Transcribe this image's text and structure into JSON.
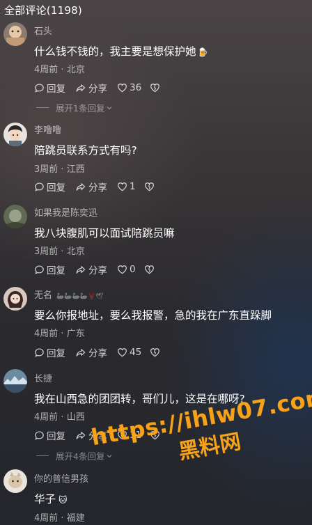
{
  "header": {
    "title": "全部评论(1198)"
  },
  "comments": [
    {
      "username": "石头",
      "text": "什么钱不钱的，我主要是想保护她",
      "emoji": "🍺",
      "time": "4周前",
      "location": "北京",
      "reply_label": "回复",
      "share_label": "分享",
      "likes": "36",
      "expand_label": "展开1条回复"
    },
    {
      "username": "李噜噜",
      "text": "陪跳员联系方式有吗?",
      "time": "3周前",
      "location": "江西",
      "reply_label": "回复",
      "share_label": "分享",
      "likes": "1"
    },
    {
      "username": "如果我是陈奕迅",
      "text": "我八块腹肌可以面试陪跳员嘛",
      "time": "3周前",
      "location": "北京",
      "reply_label": "回复",
      "share_label": "分享",
      "likes": "0"
    },
    {
      "username": "无名",
      "username_suffix": "🦢🦢🦢🦢🦞🕊",
      "text": "要么你报地址，要么我报警，急的我在广东直跺脚",
      "time": "4周前",
      "location": "广东",
      "reply_label": "回复",
      "share_label": "分享",
      "likes": "45"
    },
    {
      "username": "长捷",
      "text": "我在山西急的团团转，哥们儿，这是在哪呀?",
      "time": "4周前",
      "location": "山西",
      "reply_label": "回复",
      "share_label": "分享",
      "likes": "11",
      "expand_label": "展开4条回复"
    },
    {
      "username": "你的普信男孩",
      "text": "华子",
      "emoji": "🐱",
      "time": "4周前",
      "location": "福建"
    }
  ],
  "meta_separator": " · ",
  "watermark": {
    "url": "https://ihlw07.com",
    "name": "黑料网",
    "color": "#f7a21b"
  },
  "icons": [
    "comment-icon",
    "share-arrow-icon",
    "heart-icon",
    "broken-heart-icon",
    "chevron-down-icon"
  ]
}
